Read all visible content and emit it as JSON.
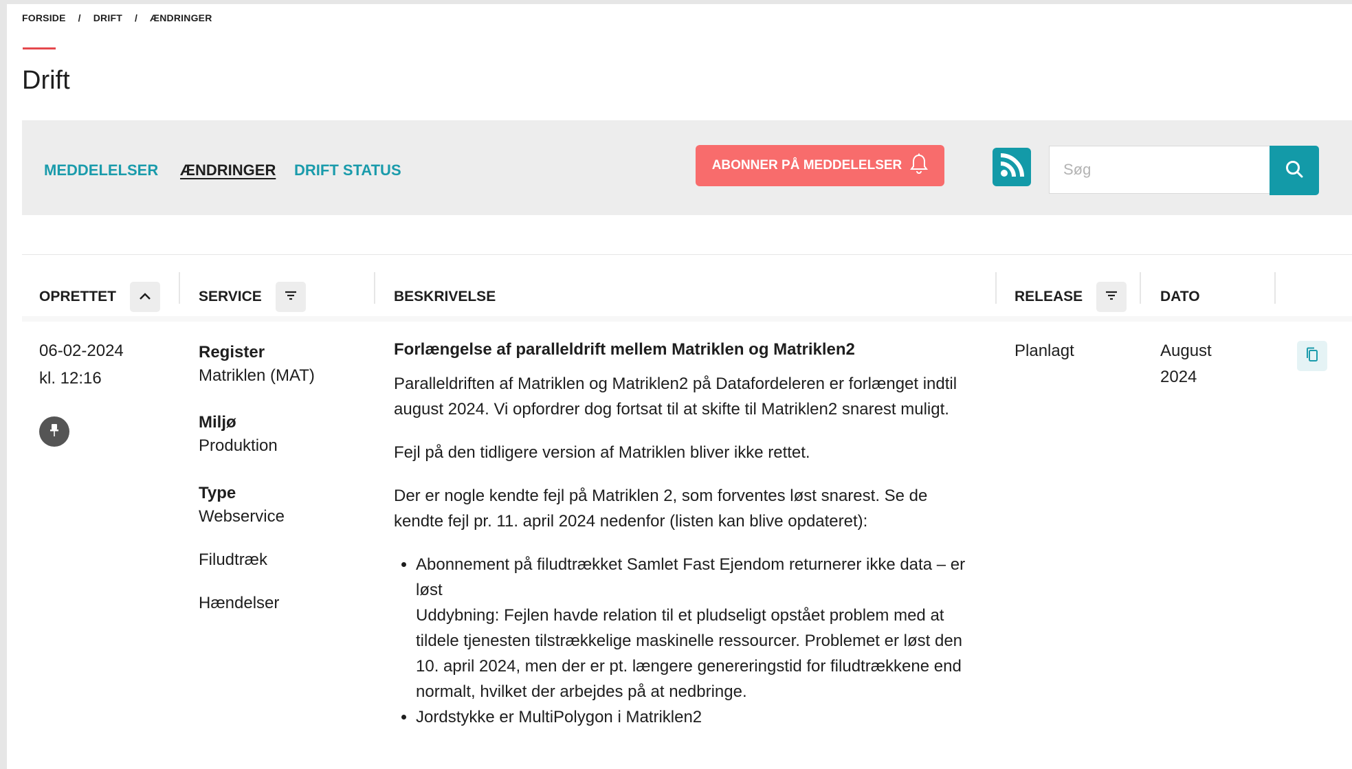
{
  "breadcrumb": {
    "items": [
      "FORSIDE",
      "DRIFT",
      "ÆNDRINGER"
    ],
    "separator": "/"
  },
  "page": {
    "title": "Drift"
  },
  "toolbar": {
    "nav": [
      {
        "label": "MEDDELELSER",
        "active": false
      },
      {
        "label": "ÆNDRINGER",
        "active": true
      },
      {
        "label": "DRIFT STATUS",
        "active": false
      }
    ],
    "subscribe_label": "ABONNER PÅ MEDDELELSER",
    "subscribe_icon": "bell-icon",
    "rss_icon": "rss-icon",
    "search": {
      "placeholder": "Søg",
      "value": "",
      "icon": "search-icon"
    }
  },
  "table": {
    "headers": {
      "created": "OPRETTET",
      "service": "SERVICE",
      "description": "BESKRIVELSE",
      "release": "RELEASE",
      "date": "DATO"
    },
    "header_icons": {
      "created": "chevron-up-icon",
      "service": "filter-icon",
      "release": "filter-icon"
    },
    "rows": [
      {
        "created_date": "06-02-2024",
        "created_time": "kl. 12:16",
        "pin_icon": "pin-icon",
        "service": {
          "register_label": "Register",
          "register_value": "Matriklen (MAT)",
          "env_label": "Miljø",
          "env_value": "Produktion",
          "type_label": "Type",
          "type_values": [
            "Webservice",
            "Filudtræk",
            "Hændelser"
          ]
        },
        "description": {
          "title": "Forlængelse af paralleldrift mellem Matriklen og Matriklen2",
          "paragraphs": [
            "Paralleldriften af Matriklen og Matriklen2 på Datafordeleren er forlænget indtil august 2024. Vi opfordrer dog fortsat til at skifte til Matriklen2 snarest muligt.",
            "Fejl på den tidligere version af Matriklen bliver ikke rettet.",
            "Der er nogle kendte fejl på Matriklen 2, som forventes løst snarest. Se de kendte fejl pr. 11. april 2024 nedenfor (listen kan blive opdateret):"
          ],
          "bullets": [
            {
              "text": "Abonnement på filudtrækket Samlet Fast Ejendom returnerer ikke data – er løst",
              "detail": "Uddybning: Fejlen havde relation til et pludseligt opstået problem med at tildele tjenesten tilstrækkelige maskinelle ressourcer. Problemet er løst den 10. april 2024, men der er pt. længere genereringstid for filudtrækkene end normalt, hvilket der arbejdes på at nedbringe."
            },
            {
              "text": "Jordstykke er MultiPolygon i Matriklen2",
              "detail": ""
            }
          ]
        },
        "release": "Planlagt",
        "date_month": "August",
        "date_year": "2024",
        "copy_icon": "copy-icon"
      }
    ]
  },
  "colors": {
    "accent_teal": "#139aa8",
    "nav_teal": "#1a9bab",
    "subscribe_red": "#f86c6c",
    "title_accent": "#e5484d",
    "toolbar_bg": "#ededed"
  }
}
